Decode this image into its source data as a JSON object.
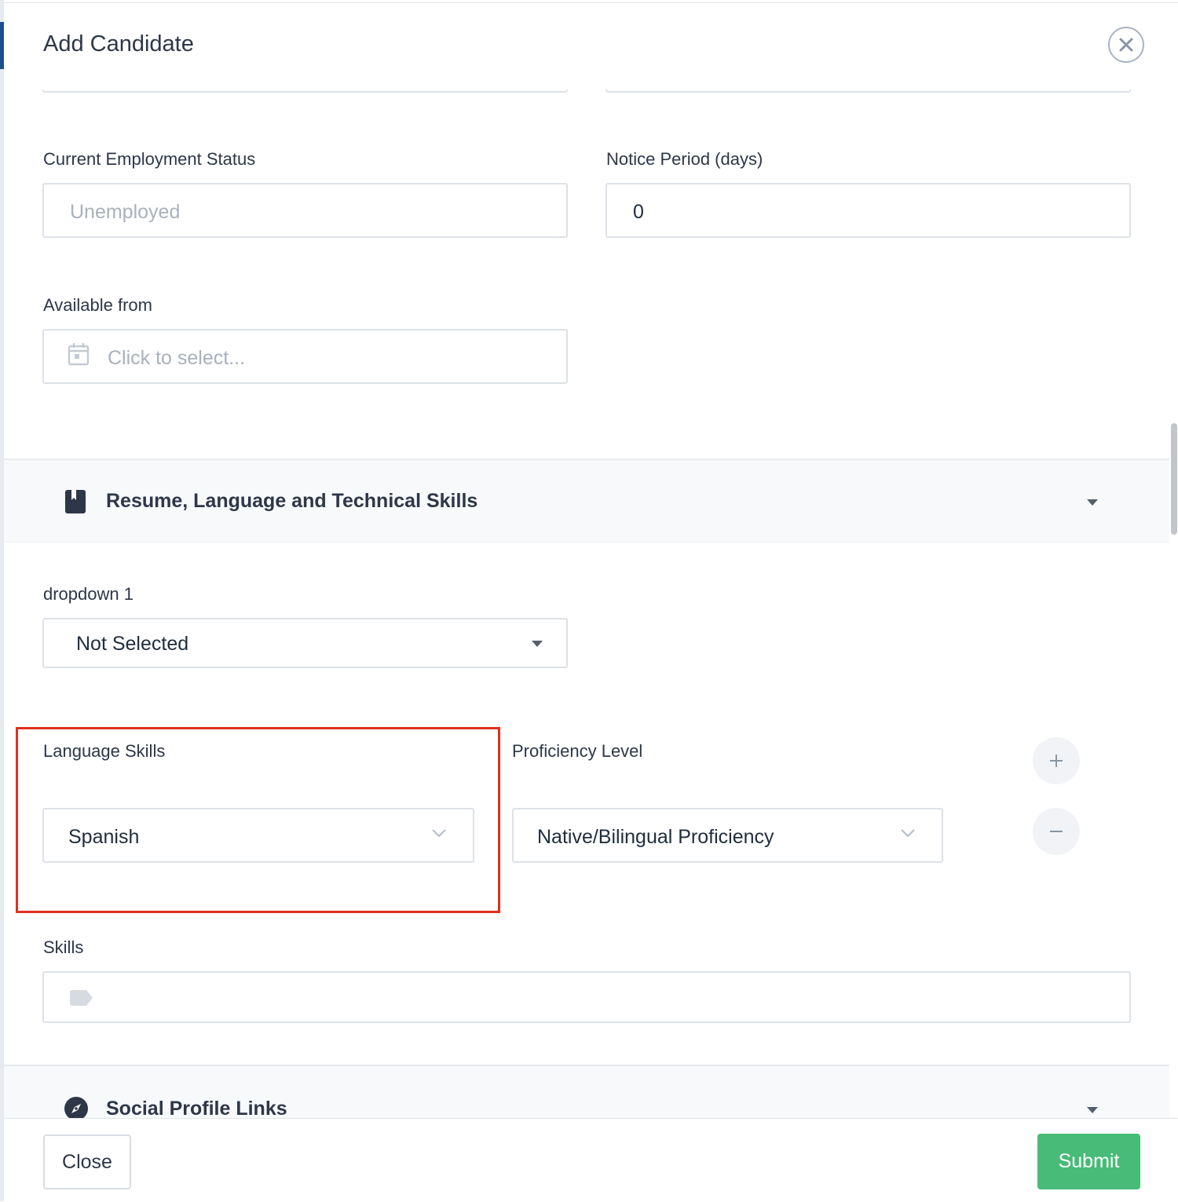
{
  "modal": {
    "title": "Add Candidate"
  },
  "employment": {
    "status_label": "Current Employment Status",
    "status_placeholder": "Unemployed",
    "notice_label": "Notice Period (days)",
    "notice_value": "0",
    "available_label": "Available from",
    "available_placeholder": "Click to select..."
  },
  "sections": {
    "skills_title": "Resume, Language and Technical Skills",
    "social_title": "Social Profile Links"
  },
  "dropdown1": {
    "label": "dropdown 1",
    "value": "Not Selected"
  },
  "language": {
    "skills_label": "Language Skills",
    "skills_value": "Spanish",
    "proficiency_label": "Proficiency Level",
    "proficiency_value": "Native/Bilingual Proficiency"
  },
  "skills": {
    "label": "Skills"
  },
  "footer": {
    "close_label": "Close",
    "submit_label": "Submit"
  },
  "colors": {
    "highlight": "#e1301c",
    "submit": "#48bb78"
  },
  "icons": {
    "close": "close-icon",
    "calendar": "calendar-icon",
    "book": "book-icon",
    "compass": "compass-icon",
    "tag": "tag-icon",
    "plus": "plus-icon",
    "minus": "minus-icon"
  }
}
